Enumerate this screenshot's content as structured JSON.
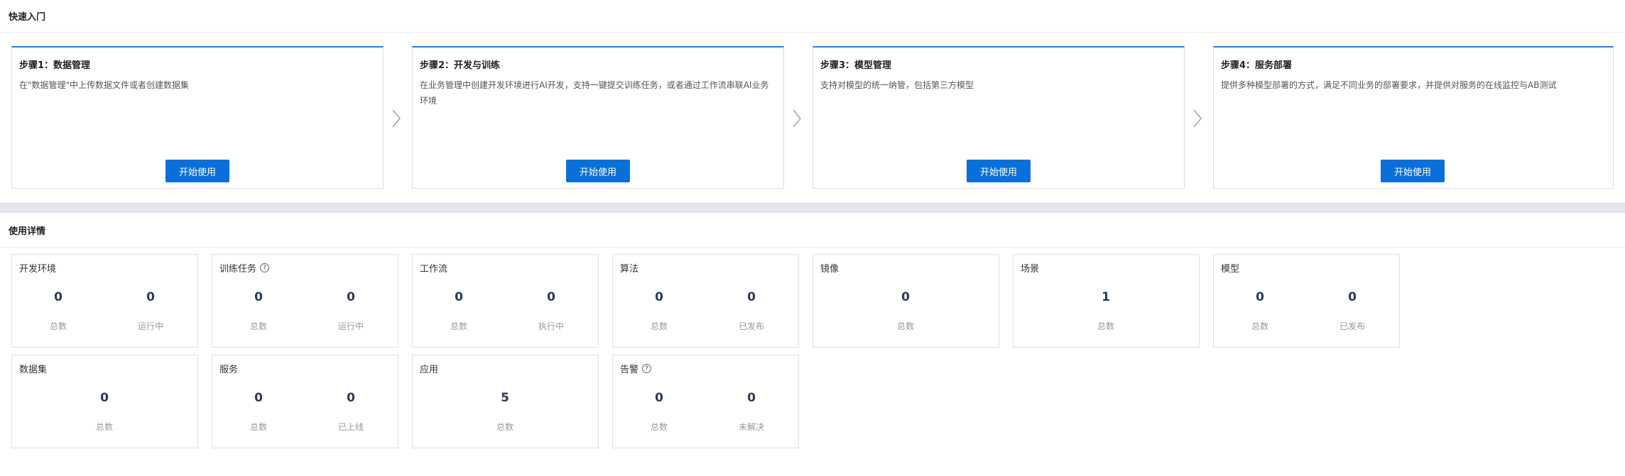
{
  "quick_start": {
    "title": "快速入门",
    "steps": [
      {
        "title": "步骤1：数据管理",
        "desc": "在\"数据管理\"中上传数据文件或者创建数据集",
        "button": "开始使用"
      },
      {
        "title": "步骤2：开发与训练",
        "desc": "在业务管理中创建开发环境进行AI开发，支持一键提交训练任务，或者通过工作流串联AI业务环境",
        "button": "开始使用"
      },
      {
        "title": "步骤3：模型管理",
        "desc": "支持对模型的统一纳管，包括第三方模型",
        "button": "开始使用"
      },
      {
        "title": "步骤4：服务部署",
        "desc": "提供多种模型部署的方式，满足不同业务的部署要求，并提供对服务的在线监控与AB测试",
        "button": "开始使用"
      }
    ]
  },
  "usage": {
    "title": "使用详情",
    "cards": [
      {
        "title": "开发环境",
        "help": false,
        "stats": [
          {
            "value": "0",
            "label": "总数"
          },
          {
            "value": "0",
            "label": "运行中"
          }
        ]
      },
      {
        "title": "训练任务",
        "help": true,
        "stats": [
          {
            "value": "0",
            "label": "总数"
          },
          {
            "value": "0",
            "label": "运行中"
          }
        ]
      },
      {
        "title": "工作流",
        "help": false,
        "stats": [
          {
            "value": "0",
            "label": "总数"
          },
          {
            "value": "0",
            "label": "执行中"
          }
        ]
      },
      {
        "title": "算法",
        "help": false,
        "stats": [
          {
            "value": "0",
            "label": "总数"
          },
          {
            "value": "0",
            "label": "已发布"
          }
        ]
      },
      {
        "title": "镜像",
        "help": false,
        "stats": [
          {
            "value": "0",
            "label": "总数"
          }
        ]
      },
      {
        "title": "场景",
        "help": false,
        "stats": [
          {
            "value": "1",
            "label": "总数"
          }
        ]
      },
      {
        "title": "模型",
        "help": false,
        "stats": [
          {
            "value": "0",
            "label": "总数"
          },
          {
            "value": "0",
            "label": "已发布"
          }
        ]
      },
      {
        "title": "数据集",
        "help": false,
        "stats": [
          {
            "value": "0",
            "label": "总数"
          }
        ]
      },
      {
        "title": "服务",
        "help": false,
        "stats": [
          {
            "value": "0",
            "label": "总数"
          },
          {
            "value": "0",
            "label": "已上线"
          }
        ]
      },
      {
        "title": "应用",
        "help": false,
        "stats": [
          {
            "value": "5",
            "label": "总数"
          }
        ]
      },
      {
        "title": "告警",
        "help": true,
        "stats": [
          {
            "value": "0",
            "label": "总数"
          },
          {
            "value": "0",
            "label": "未解决"
          }
        ]
      }
    ]
  },
  "icons": {
    "step_arrow": "chevron-right-icon",
    "help": "question-circle-icon"
  },
  "colors": {
    "accent": "#0b6fd9",
    "card_top_border": "#2a7fd8",
    "stat_value": "#2c3a57",
    "band": "#e4e8ee"
  }
}
